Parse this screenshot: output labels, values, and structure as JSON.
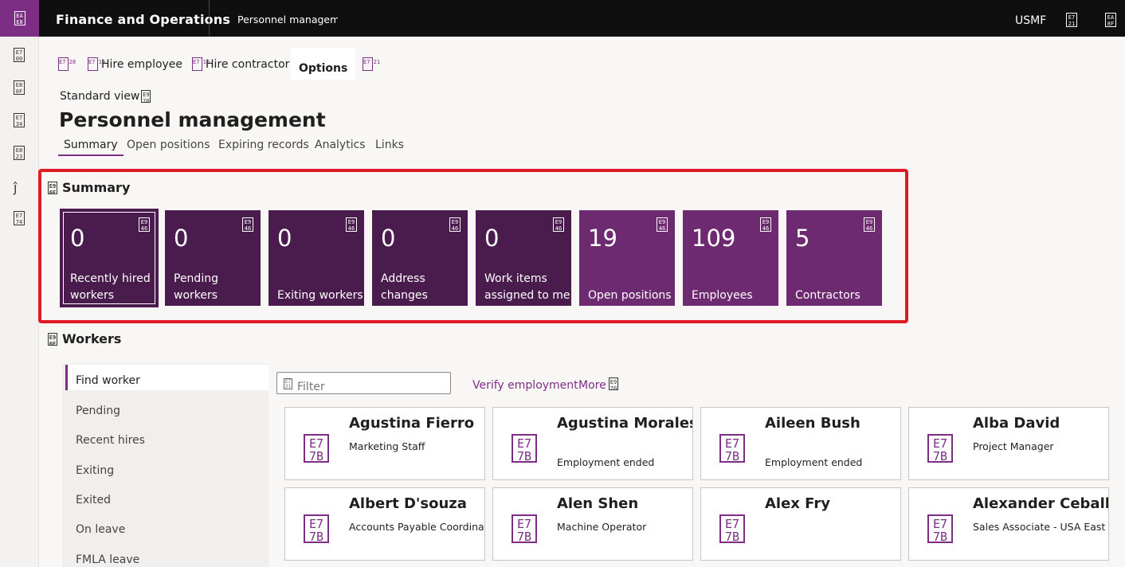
{
  "topbar": {
    "app_title": "Finance and Operations",
    "breadcrumb": "Personnel management",
    "company": "USMF",
    "icon_codes": {
      "waffle": "EA E8",
      "help": "E7 21",
      "settings": "EA 8F"
    }
  },
  "navrail": {
    "items": [
      {
        "name": "hamburger",
        "code": "E7 00"
      },
      {
        "name": "home",
        "code": "E8 0F"
      },
      {
        "name": "favorites",
        "code": "E7 34"
      },
      {
        "name": "recent",
        "code": "E8 23"
      },
      {
        "name": "workspaces",
        "glyph": "ĵ"
      },
      {
        "name": "modules",
        "code": "E7 74"
      }
    ]
  },
  "actionbar": {
    "hamburger_code": "E7 28",
    "hire_employee_code": "E7 10",
    "hire_employee": "Hire employee",
    "hire_contractor_code": "E7 10",
    "hire_contractor": "Hire contractor",
    "options": "Options",
    "search_code": "E7 21"
  },
  "view": {
    "standard_view": "Standard view",
    "chevron_code": "E9 70",
    "page_title": "Personnel management"
  },
  "tabs": [
    "Summary",
    "Open positions",
    "Expiring records",
    "Analytics",
    "Links"
  ],
  "summary": {
    "section_code": "E9 6E",
    "title": "Summary",
    "tile_icon_code": "E9 46",
    "tiles": [
      {
        "count": "0",
        "label": "Recently hired\nworkers"
      },
      {
        "count": "0",
        "label": "Pending\nworkers"
      },
      {
        "count": "0",
        "label": "Exiting workers"
      },
      {
        "count": "0",
        "label": "Address\nchanges"
      },
      {
        "count": "0",
        "label": "Work items\nassigned to me"
      },
      {
        "count": "19",
        "label": "Open positions"
      },
      {
        "count": "109",
        "label": "Employees"
      },
      {
        "count": "5",
        "label": "Contractors"
      }
    ]
  },
  "workers": {
    "section_code": "E9 6E",
    "title": "Workers",
    "list": [
      "Find worker",
      "Pending",
      "Recent hires",
      "Exiting",
      "Exited",
      "On leave",
      "FMLA leave"
    ],
    "filter_code": "E7 21",
    "filter_placeholder": "Filter",
    "verify_employment": "Verify employment",
    "more": "More",
    "more_code": "E9 70",
    "avatar_code": "E7 7B",
    "cards": [
      {
        "name": "Agustina Fierro",
        "role": "Marketing Staff"
      },
      {
        "name": "Agustina Morales",
        "role": "Employment ended"
      },
      {
        "name": "Aileen Bush",
        "role": "Employment ended"
      },
      {
        "name": "Alba David",
        "role": "Project Manager"
      },
      {
        "name": "Albert D'souza",
        "role": "Accounts Payable Coordinator"
      },
      {
        "name": "Alen Shen",
        "role": "Machine Operator"
      },
      {
        "name": "Alex Fry",
        "role": ""
      },
      {
        "name": "Alexander Ceballos",
        "role": "Sales Associate - USA East"
      }
    ]
  }
}
